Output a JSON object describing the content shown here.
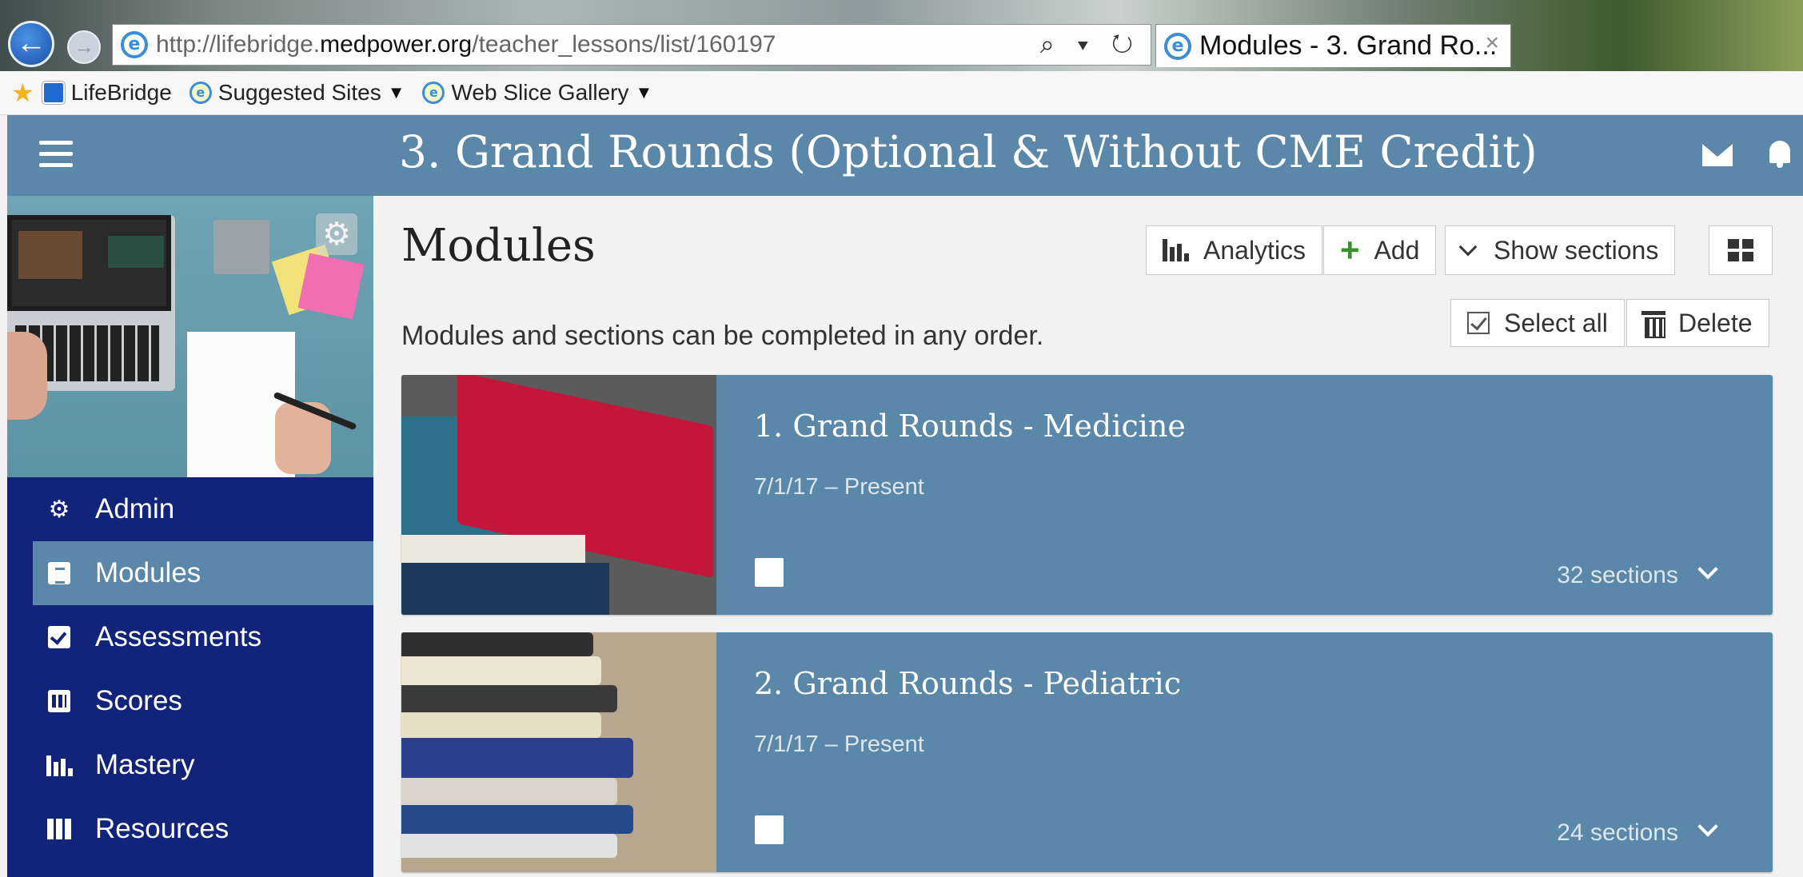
{
  "browser": {
    "url_prefix": "http://lifebridge.",
    "url_host": "medpower.org",
    "url_path": "/teacher_lessons/list/160197",
    "url_tools": "⌕ ▾ ↻",
    "tab_title": "Modules - 3. Grand Ro...",
    "tab_close": "×",
    "favorites": [
      {
        "label": "LifeBridge"
      },
      {
        "label": "Suggested Sites",
        "caret": "▼"
      },
      {
        "label": "Web Slice Gallery",
        "caret": "▼"
      }
    ]
  },
  "header": {
    "title": "3. Grand Rounds (Optional & Without CME Credit)"
  },
  "sidebar": {
    "gear": "⚙",
    "items": [
      {
        "label": "Admin",
        "icon": "gear-icon"
      },
      {
        "label": "Modules",
        "icon": "book-icon",
        "active": true
      },
      {
        "label": "Assessments",
        "icon": "checkbox-icon"
      },
      {
        "label": "Scores",
        "icon": "gradebook-icon"
      },
      {
        "label": "Mastery",
        "icon": "bar-chart-icon"
      },
      {
        "label": "Resources",
        "icon": "resources-icon"
      }
    ]
  },
  "main": {
    "title": "Modules",
    "subtitle": "Modules and sections can be completed in any order.",
    "toolbar": {
      "analytics": "Analytics",
      "add": "Add",
      "show_sections": "Show sections",
      "select_all": "Select all",
      "delete": "Delete"
    },
    "modules": [
      {
        "title": "1. Grand Rounds - Medicine",
        "dates": "7/1/17 – Present",
        "sections": "32 sections"
      },
      {
        "title": "2. Grand Rounds - Pediatric",
        "dates": "7/1/17 – Present",
        "sections": "24 sections"
      }
    ]
  },
  "colors": {
    "header": "#5b87a8",
    "sidebar": "#12237a",
    "card": "#5b87a8",
    "add_plus": "#3c8d2f"
  }
}
